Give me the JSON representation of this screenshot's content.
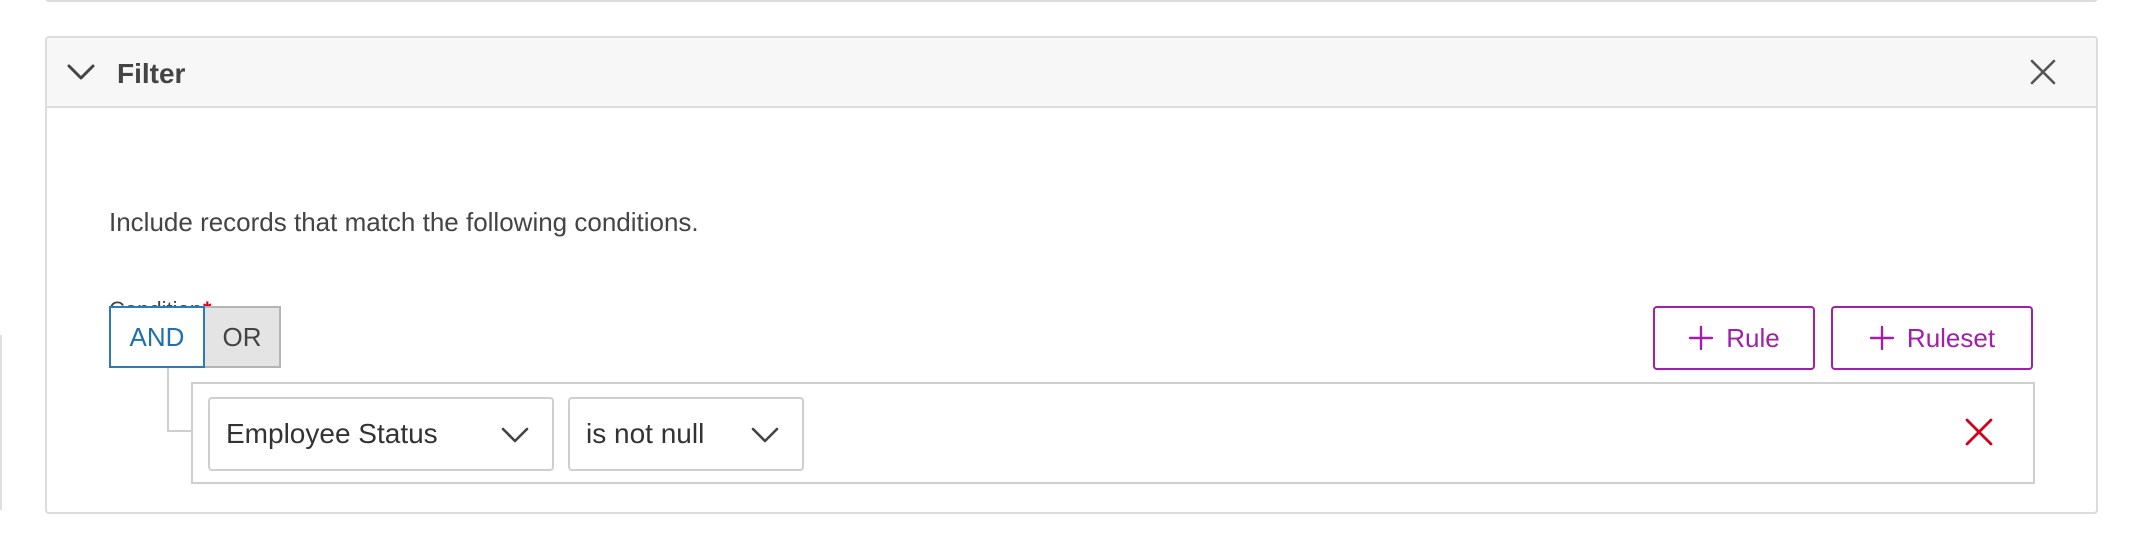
{
  "panel": {
    "title": "Filter",
    "collapse_icon": "chevron-down-icon",
    "close_icon": "close-icon"
  },
  "filter": {
    "description": "Include records that match the following conditions.",
    "condition_label": "Condition",
    "required_marker": "*",
    "combinators": {
      "and_label": "AND",
      "or_label": "OR",
      "selected": "AND"
    },
    "actions": {
      "add_rule_label": "Rule",
      "add_ruleset_label": "Ruleset",
      "plus_icon": "plus-icon"
    },
    "rule": {
      "field_value": "Employee Status",
      "operator_value": "is not null",
      "remove_icon": "remove-icon"
    }
  },
  "colors": {
    "accent_purple": "#a020a8",
    "selected_blue": "#1f6fb2",
    "danger_red": "#d0021b",
    "border_gray": "#dcdcdc"
  }
}
